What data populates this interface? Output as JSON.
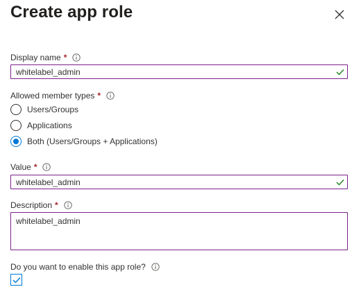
{
  "panel": {
    "title": "Create app role"
  },
  "display_name": {
    "label": "Display name",
    "required_mark": "*",
    "value": "whitelabel_admin"
  },
  "member_types": {
    "label": "Allowed member types",
    "required_mark": "*",
    "options": [
      {
        "label": "Users/Groups",
        "checked": false
      },
      {
        "label": "Applications",
        "checked": false
      },
      {
        "label": "Both (Users/Groups + Applications)",
        "checked": true
      }
    ]
  },
  "value_field": {
    "label": "Value",
    "required_mark": "*",
    "value": "whitelabel_admin"
  },
  "description": {
    "label": "Description",
    "required_mark": "*",
    "value": "whitelabel_admin"
  },
  "enable_role": {
    "label": "Do you want to enable this app role?",
    "checked": true
  },
  "colors": {
    "accent": "#0078d4",
    "valid": "#107c10",
    "focus_border": "#7a1f8a",
    "required": "#a4262c"
  },
  "icons": [
    "close-icon",
    "info-icon",
    "checkmark-icon",
    "checkbox-check-icon"
  ]
}
